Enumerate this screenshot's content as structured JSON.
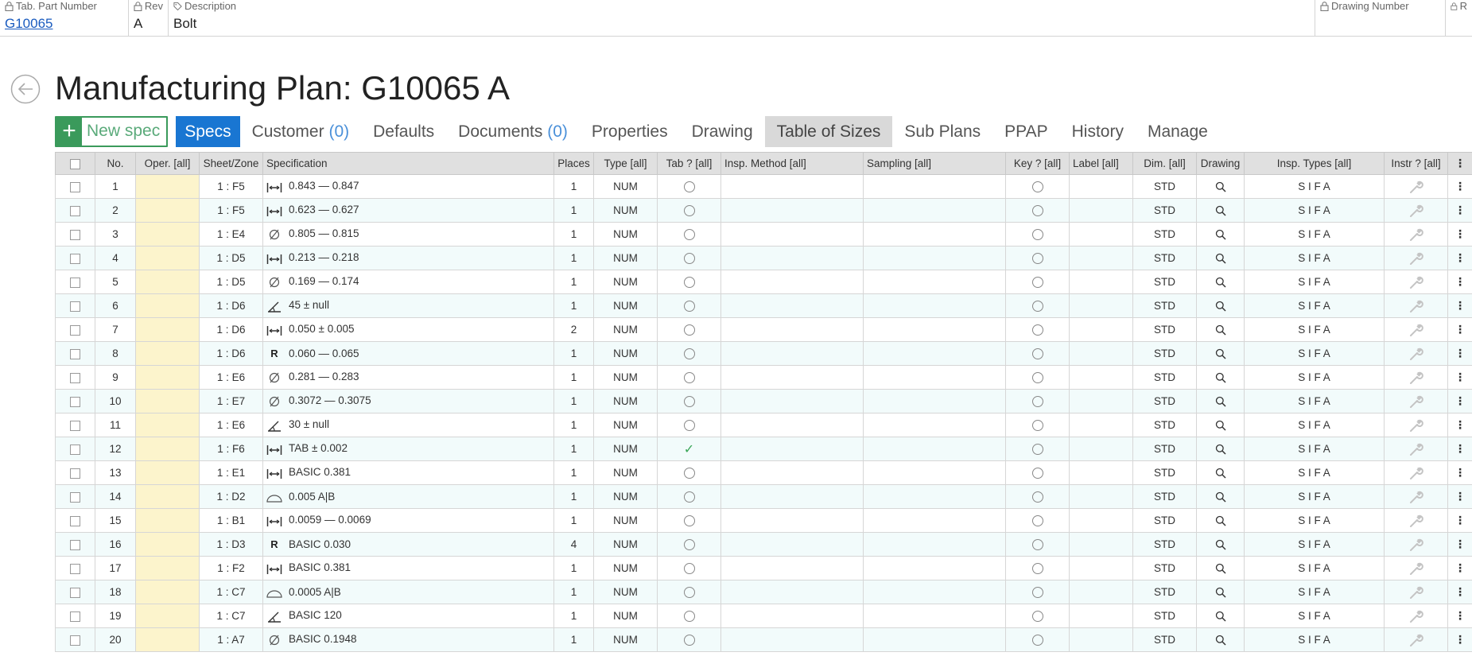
{
  "header": {
    "part_label": "Tab. Part Number",
    "part_value": "G10065",
    "rev_label": "Rev",
    "rev_value": "A",
    "desc_label": "Description",
    "desc_value": "Bolt",
    "drawing_label": "Drawing Number",
    "drawing_value": "",
    "cut_label": "R"
  },
  "page": {
    "title": "Manufacturing Plan: G10065 A"
  },
  "tabs": {
    "new_spec": "New spec",
    "specs": "Specs",
    "customer": "Customer",
    "customer_count": "(0)",
    "defaults": "Defaults",
    "documents": "Documents",
    "documents_count": "(0)",
    "properties": "Properties",
    "drawing": "Drawing",
    "table_of_sizes": "Table of Sizes",
    "sub_plans": "Sub Plans",
    "ppap": "PPAP",
    "history": "History",
    "manage": "Manage"
  },
  "columns": {
    "no": "No.",
    "oper": "Oper. [all]",
    "sheet_zone": "Sheet/Zone",
    "specification": "Specification",
    "places": "Places",
    "type": "Type [all]",
    "tab": "Tab ? [all]",
    "insp_method": "Insp. Method [all]",
    "sampling": "Sampling [all]",
    "key": "Key ? [all]",
    "label": "Label [all]",
    "dim": "Dim. [all]",
    "drawing": "Drawing",
    "insp_types": "Insp. Types [all]",
    "instr": "Instr ? [all]"
  },
  "rows": [
    {
      "no": "1",
      "zone": "1 : F5",
      "icon": "linear-dimension-icon",
      "spec": "0.843 — 0.847",
      "places": "1",
      "type": "NUM",
      "tab": false,
      "dim": "STD",
      "insp": "S I F A"
    },
    {
      "no": "2",
      "zone": "1 : F5",
      "icon": "linear-dimension-icon",
      "spec": "0.623 — 0.627",
      "places": "1",
      "type": "NUM",
      "tab": false,
      "dim": "STD",
      "insp": "S I F A"
    },
    {
      "no": "3",
      "zone": "1 : E4",
      "icon": "diameter-icon",
      "spec": "0.805 — 0.815",
      "places": "1",
      "type": "NUM",
      "tab": false,
      "dim": "STD",
      "insp": "S I F A"
    },
    {
      "no": "4",
      "zone": "1 : D5",
      "icon": "linear-dimension-icon",
      "spec": "0.213 — 0.218",
      "places": "1",
      "type": "NUM",
      "tab": false,
      "dim": "STD",
      "insp": "S I F A"
    },
    {
      "no": "5",
      "zone": "1 : D5",
      "icon": "diameter-icon",
      "spec": "0.169 — 0.174",
      "places": "1",
      "type": "NUM",
      "tab": false,
      "dim": "STD",
      "insp": "S I F A"
    },
    {
      "no": "6",
      "zone": "1 : D6",
      "icon": "angle-icon",
      "spec": "45 ± null",
      "places": "1",
      "type": "NUM",
      "tab": false,
      "dim": "STD",
      "insp": "S I F A"
    },
    {
      "no": "7",
      "zone": "1 : D6",
      "icon": "linear-dimension-icon",
      "spec": "0.050 ± 0.005",
      "places": "2",
      "type": "NUM",
      "tab": false,
      "dim": "STD",
      "insp": "S I F A"
    },
    {
      "no": "8",
      "zone": "1 : D6",
      "icon": "radius-icon",
      "spec": "0.060 — 0.065",
      "places": "1",
      "type": "NUM",
      "tab": false,
      "dim": "STD",
      "insp": "S I F A"
    },
    {
      "no": "9",
      "zone": "1 : E6",
      "icon": "diameter-icon",
      "spec": "0.281 — 0.283",
      "places": "1",
      "type": "NUM",
      "tab": false,
      "dim": "STD",
      "insp": "S I F A"
    },
    {
      "no": "10",
      "zone": "1 : E7",
      "icon": "diameter-icon",
      "spec": "0.3072 — 0.3075",
      "places": "1",
      "type": "NUM",
      "tab": false,
      "dim": "STD",
      "insp": "S I F A"
    },
    {
      "no": "11",
      "zone": "1 : E6",
      "icon": "angle-icon",
      "spec": "30 ± null",
      "places": "1",
      "type": "NUM",
      "tab": false,
      "dim": "STD",
      "insp": "S I F A"
    },
    {
      "no": "12",
      "zone": "1 : F6",
      "icon": "linear-dimension-icon",
      "spec": "TAB ± 0.002",
      "places": "1",
      "type": "NUM",
      "tab": true,
      "dim": "STD",
      "insp": "S I F A"
    },
    {
      "no": "13",
      "zone": "1 : E1",
      "icon": "linear-dimension-icon",
      "spec": "BASIC 0.381",
      "places": "1",
      "type": "NUM",
      "tab": false,
      "dim": "STD",
      "insp": "S I F A"
    },
    {
      "no": "14",
      "zone": "1 : D2",
      "icon": "profile-icon",
      "spec": "0.005 A|B",
      "places": "1",
      "type": "NUM",
      "tab": false,
      "dim": "STD",
      "insp": "S I F A"
    },
    {
      "no": "15",
      "zone": "1 : B1",
      "icon": "linear-dimension-icon",
      "spec": "0.0059 — 0.0069",
      "places": "1",
      "type": "NUM",
      "tab": false,
      "dim": "STD",
      "insp": "S I F A"
    },
    {
      "no": "16",
      "zone": "1 : D3",
      "icon": "radius-icon",
      "spec": "BASIC 0.030",
      "places": "4",
      "type": "NUM",
      "tab": false,
      "dim": "STD",
      "insp": "S I F A"
    },
    {
      "no": "17",
      "zone": "1 : F2",
      "icon": "linear-dimension-icon",
      "spec": "BASIC 0.381",
      "places": "1",
      "type": "NUM",
      "tab": false,
      "dim": "STD",
      "insp": "S I F A"
    },
    {
      "no": "18",
      "zone": "1 : C7",
      "icon": "profile-icon",
      "spec": "0.0005 A|B",
      "places": "1",
      "type": "NUM",
      "tab": false,
      "dim": "STD",
      "insp": "S I F A"
    },
    {
      "no": "19",
      "zone": "1 : C7",
      "icon": "angle-icon",
      "spec": "BASIC 120",
      "places": "1",
      "type": "NUM",
      "tab": false,
      "dim": "STD",
      "insp": "S I F A"
    },
    {
      "no": "20",
      "zone": "1 : A7",
      "icon": "diameter-icon",
      "spec": "BASIC 0.1948",
      "places": "1",
      "type": "NUM",
      "tab": false,
      "dim": "STD",
      "insp": "S I F A"
    }
  ],
  "colors": {
    "accent": "#1976d2",
    "new_spec": "#3a9a5b",
    "oper_fill": "#fcf4cc",
    "row_alt": "#f2fbfb",
    "check": "#3aa657"
  }
}
